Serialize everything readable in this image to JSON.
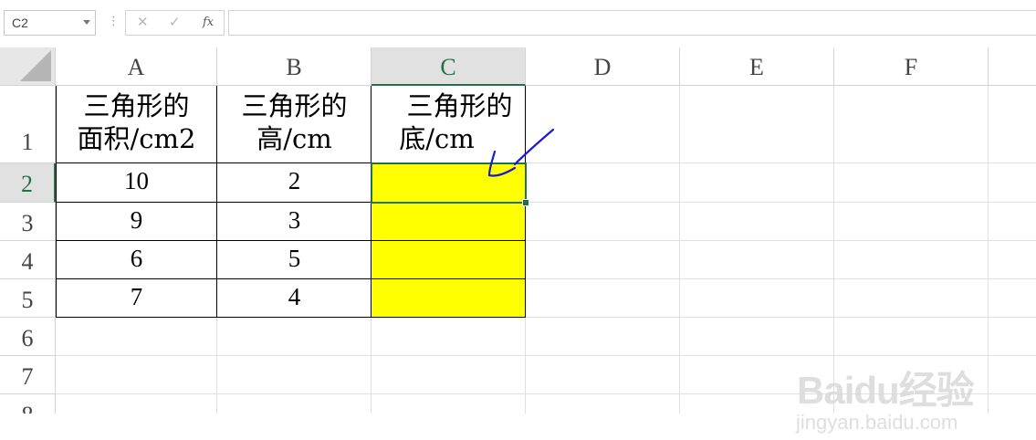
{
  "formula_bar": {
    "name_box": "C2",
    "cancel_icon": "✕",
    "enter_icon": "✓",
    "function_label": "fx",
    "formula": ""
  },
  "columns": [
    "A",
    "B",
    "C",
    "D",
    "E",
    "F"
  ],
  "rows": [
    "1",
    "2",
    "3",
    "4",
    "5",
    "6",
    "7",
    "8"
  ],
  "active_cell": "C2",
  "table": {
    "headers": [
      {
        "line1": "三角形的",
        "line2": "面积/cm2"
      },
      {
        "line1": "三角形的",
        "line2": "高/cm"
      },
      {
        "line1": "三角形的",
        "line2": "底/cm"
      }
    ],
    "rows": [
      [
        "10",
        "2",
        ""
      ],
      [
        "9",
        "3",
        ""
      ],
      [
        "6",
        "5",
        ""
      ],
      [
        "7",
        "4",
        ""
      ]
    ]
  },
  "colors": {
    "highlight_fill": "#ffff00",
    "selection_green": "#217346",
    "annotation_blue": "#1a1ad6"
  },
  "watermark": {
    "main": "Baidu经验",
    "sub": "jingyan.baidu.com"
  }
}
